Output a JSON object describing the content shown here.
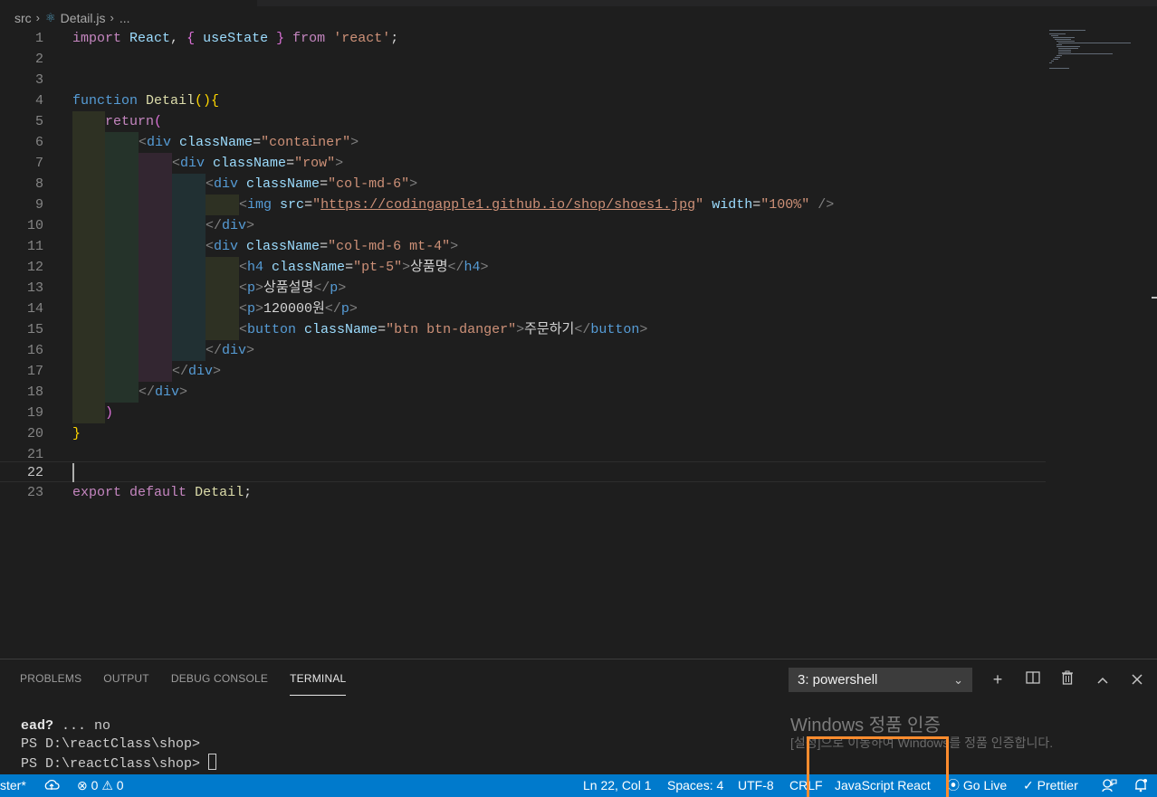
{
  "breadcrumb": {
    "folder": "src",
    "file": "Detail.js",
    "more": "..."
  },
  "editor": {
    "current_line": 22,
    "lines": [
      {
        "n": "1"
      },
      {
        "n": "2"
      },
      {
        "n": "3"
      },
      {
        "n": "4"
      },
      {
        "n": "5"
      },
      {
        "n": "6"
      },
      {
        "n": "7"
      },
      {
        "n": "8"
      },
      {
        "n": "9"
      },
      {
        "n": "10"
      },
      {
        "n": "11"
      },
      {
        "n": "12"
      },
      {
        "n": "13"
      },
      {
        "n": "14"
      },
      {
        "n": "15"
      },
      {
        "n": "16"
      },
      {
        "n": "17"
      },
      {
        "n": "18"
      },
      {
        "n": "19"
      },
      {
        "n": "20"
      },
      {
        "n": "21"
      },
      {
        "n": "22"
      },
      {
        "n": "23"
      }
    ],
    "tokens": {
      "import": "import",
      "React": "React",
      "useState": "useState",
      "from": "from",
      "react_str": "'react'",
      "function": "function",
      "Detail": "Detail",
      "return": "return",
      "div": "div",
      "className": "className",
      "img": "img",
      "src": "src",
      "width": "width",
      "h4": "h4",
      "p": "p",
      "button": "button",
      "container": "\"container\"",
      "row": "\"row\"",
      "col6": "\"col-md-6\"",
      "col6mt4": "\"col-md-6 mt-4\"",
      "url": "https://codingapple1.github.io/shop/shoes1.jpg",
      "w100": "\"100%\"",
      "pt5": "\"pt-5\"",
      "btn": "\"btn btn-danger\"",
      "product_name": "상품명",
      "product_desc": "상품설명",
      "price": "120000원",
      "order": "주문하기",
      "export": "export",
      "default": "default"
    }
  },
  "panel": {
    "tabs": [
      "PROBLEMS",
      "OUTPUT",
      "DEBUG CONSOLE",
      "TERMINAL"
    ],
    "active_tab": "TERMINAL",
    "terminal_select": "3: powershell",
    "terminal_lines": {
      "line1_bold": "ead?",
      "line1_rest": " ... no",
      "line2": "PS D:\\reactClass\\shop>",
      "line3": "PS D:\\reactClass\\shop> "
    }
  },
  "watermark": {
    "title": "Windows 정품 인증",
    "subtitle": "[설정]으로 이동하여 Windows를 정품 인증합니다."
  },
  "statusbar": {
    "branch": "ster*",
    "errors": "0",
    "warnings": "0",
    "position": "Ln 22, Col 1",
    "spaces": "Spaces: 4",
    "encoding": "UTF-8",
    "eol": "CRLF",
    "language": "JavaScript React",
    "golive": "Go Live",
    "prettier": "Prettier"
  },
  "colors": {
    "statusbar": "#007acc",
    "highlight": "#ff8c2e",
    "editor_bg": "#1e1e1e"
  }
}
